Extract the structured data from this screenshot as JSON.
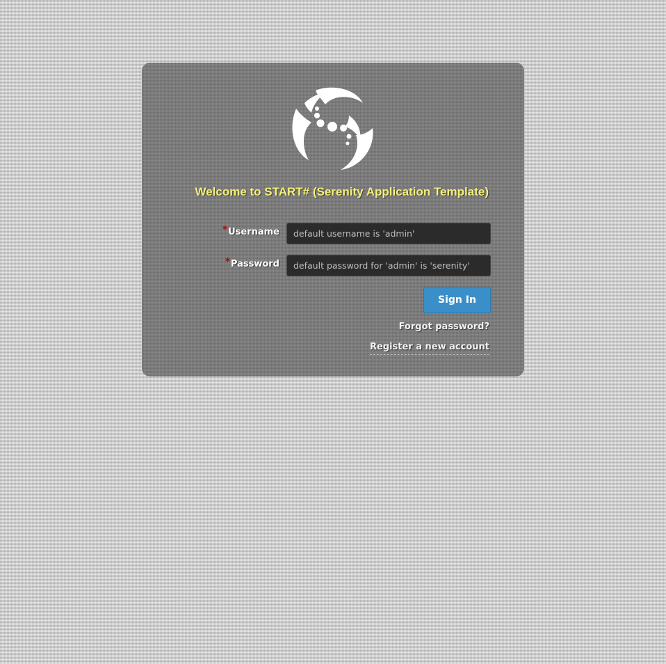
{
  "colors": {
    "page_background": "#c9c9c9",
    "panel_background": "#7a7a7a",
    "title_text": "#f5f07a",
    "input_background": "#2b2b2b",
    "sign_in_button": "#3a8fc9",
    "required_star": "#b80000"
  },
  "logo": {
    "icon": "serenity-swirl-logo"
  },
  "title": "Welcome to START# (Serenity Application Template)",
  "form": {
    "username": {
      "required_mark": "*",
      "label": "Username",
      "placeholder": "default username is 'admin'",
      "value": ""
    },
    "password": {
      "required_mark": "*",
      "label": "Password",
      "placeholder": "default password for 'admin' is 'serenity'",
      "value": ""
    },
    "sign_in_label": "Sign In"
  },
  "links": {
    "forgot_password": "Forgot password?",
    "register": "Register a new account"
  }
}
